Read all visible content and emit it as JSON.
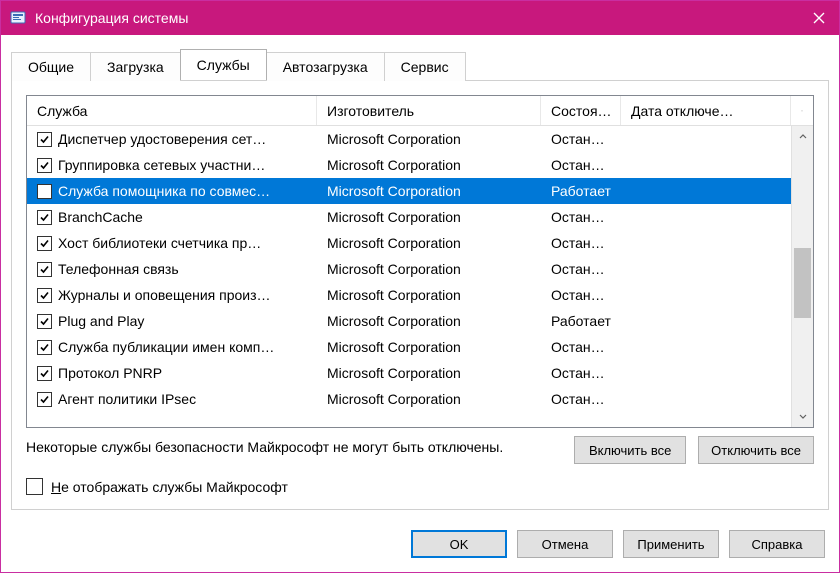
{
  "window": {
    "title": "Конфигурация системы"
  },
  "tabs": [
    {
      "label": "Общие",
      "active": false
    },
    {
      "label": "Загрузка",
      "active": false
    },
    {
      "label": "Службы",
      "active": true
    },
    {
      "label": "Автозагрузка",
      "active": false
    },
    {
      "label": "Сервис",
      "active": false
    }
  ],
  "columns": {
    "service": "Служба",
    "vendor": "Изготовитель",
    "state": "Состоя…",
    "date": "Дата отключе…"
  },
  "services": [
    {
      "checked": true,
      "name": "Диспетчер удостоверения сет…",
      "vendor": "Microsoft Corporation",
      "state": "Остан…",
      "selected": false
    },
    {
      "checked": true,
      "name": "Группировка сетевых участни…",
      "vendor": "Microsoft Corporation",
      "state": "Остан…",
      "selected": false
    },
    {
      "checked": false,
      "name": "Служба помощника по совмес…",
      "vendor": "Microsoft Corporation",
      "state": "Работает",
      "selected": true
    },
    {
      "checked": true,
      "name": "BranchCache",
      "vendor": "Microsoft Corporation",
      "state": "Остан…",
      "selected": false
    },
    {
      "checked": true,
      "name": "Хост библиотеки счетчика пр…",
      "vendor": "Microsoft Corporation",
      "state": "Остан…",
      "selected": false
    },
    {
      "checked": true,
      "name": "Телефонная связь",
      "vendor": "Microsoft Corporation",
      "state": "Остан…",
      "selected": false
    },
    {
      "checked": true,
      "name": "Журналы и оповещения произ…",
      "vendor": "Microsoft Corporation",
      "state": "Остан…",
      "selected": false
    },
    {
      "checked": true,
      "name": "Plug and Play",
      "vendor": "Microsoft Corporation",
      "state": "Работает",
      "selected": false
    },
    {
      "checked": true,
      "name": "Служба публикации имен комп…",
      "vendor": "Microsoft Corporation",
      "state": "Остан…",
      "selected": false
    },
    {
      "checked": true,
      "name": "Протокол PNRP",
      "vendor": "Microsoft Corporation",
      "state": "Остан…",
      "selected": false
    },
    {
      "checked": true,
      "name": "Агент политики IPsec",
      "vendor": "Microsoft Corporation",
      "state": "Остан…",
      "selected": false
    }
  ],
  "note": "Некоторые службы безопасности Майкрософт не могут быть отключены.",
  "buttons": {
    "enable_all": "Включить все",
    "disable_all": "Отключить все",
    "ok": "OK",
    "cancel": "Отмена",
    "apply": "Применить",
    "help": "Справка"
  },
  "hide_ms": {
    "prefix": "Н",
    "rest": "е отображать службы Майкрософт",
    "checked": false
  }
}
